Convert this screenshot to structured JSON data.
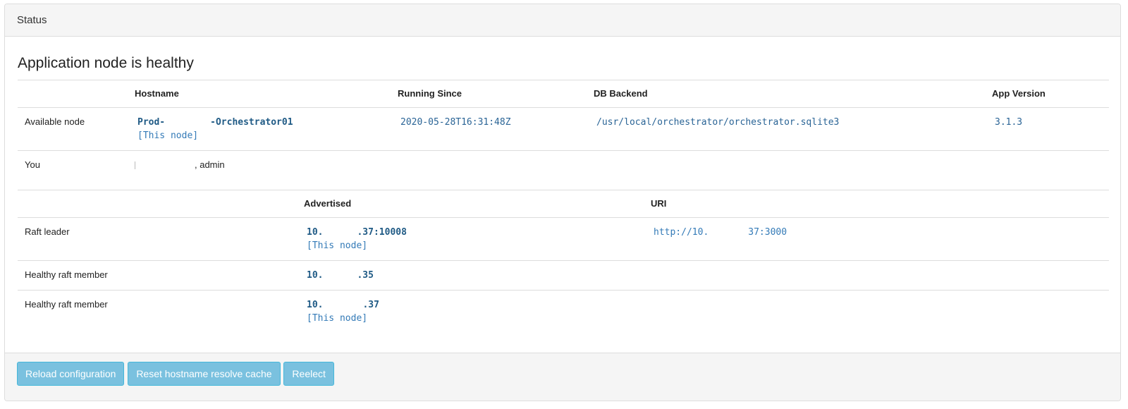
{
  "panel": {
    "title": "Status"
  },
  "heading": "Application node is healthy",
  "nodes_table": {
    "headers": [
      "",
      "Hostname",
      "Running Since",
      "DB Backend",
      "App Version"
    ],
    "available": {
      "label": "Available node",
      "hostname_prefix": "Prod-",
      "hostname_suffix": "-Orchestrator01",
      "this_node": "[This node]",
      "running_since": "2020-05-28T16:31:48Z",
      "db_backend": "/usr/local/orchestrator/orchestrator.sqlite3",
      "app_version": "3.1.3"
    },
    "you": {
      "label": "You",
      "value": ", admin"
    }
  },
  "raft_table": {
    "headers": [
      "",
      "Advertised",
      "URI"
    ],
    "rows": [
      {
        "label": "Raft leader",
        "advertised_prefix": "10.",
        "advertised_suffix": ".37:10008",
        "this_node": "[This node]",
        "uri_prefix": "http://10.",
        "uri_suffix": "37:3000"
      },
      {
        "label": "Healthy raft member",
        "advertised_prefix": "10.",
        "advertised_suffix": ".35"
      },
      {
        "label": "Healthy raft member",
        "advertised_prefix": "10.",
        "advertised_suffix": ".37",
        "this_node": "[This node]"
      }
    ]
  },
  "footer": {
    "reload": "Reload configuration",
    "reset": "Reset hostname resolve cache",
    "reelect": "Reelect"
  },
  "colors": {
    "button_bg": "#7ac1df",
    "link": "#337ab7",
    "panel_heading_bg": "#f5f5f5"
  }
}
